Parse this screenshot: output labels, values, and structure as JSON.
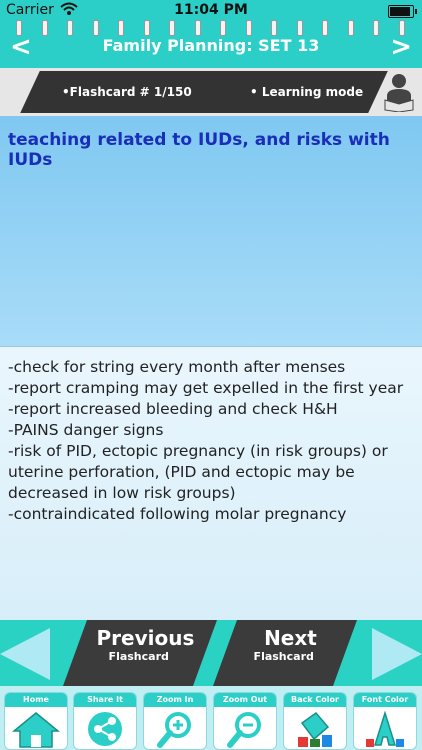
{
  "status": {
    "carrier": "Carrier",
    "time": "11:04 PM",
    "battery_level": 1.0
  },
  "nav": {
    "back_symbol": "<",
    "title": "Family Planning: SET 13",
    "forward_symbol": ">"
  },
  "info": {
    "flashcard_label": "•Flashcard #  1/150",
    "mode_label": "• Learning mode",
    "avatar_icon": "reader-icon"
  },
  "question": "teaching related to IUDs, and risks with IUDs",
  "answer_lines": [
    "-check for string every month after menses",
    "-report cramping may get expelled in the first year",
    "-report increased bleeding and check H&H",
    "-PAINS danger signs",
    "-risk of PID, ectopic pregnancy (in risk groups) or",
    "uterine perforation, (PID and ectopic may be",
    "decreased in low risk groups)",
    "-contraindicated following molar pregnancy"
  ],
  "pager": {
    "previous": {
      "title": "Previous",
      "sub": "Flashcard"
    },
    "next": {
      "title": "Next",
      "sub": "Flashcard"
    }
  },
  "toolbar": [
    {
      "label": "Home",
      "icon": "home-icon"
    },
    {
      "label": "Share It",
      "icon": "share-icon"
    },
    {
      "label": "Zoom In",
      "icon": "zoom-in-icon"
    },
    {
      "label": "Zoom Out",
      "icon": "zoom-out-icon"
    },
    {
      "label": "Back Color",
      "icon": "paint-bucket-icon"
    },
    {
      "label": "Font Color",
      "icon": "font-color-icon"
    }
  ],
  "colors": {
    "accent": "#2bcfc7",
    "question_text": "#1a2fb9",
    "dark_panel": "#333333"
  }
}
